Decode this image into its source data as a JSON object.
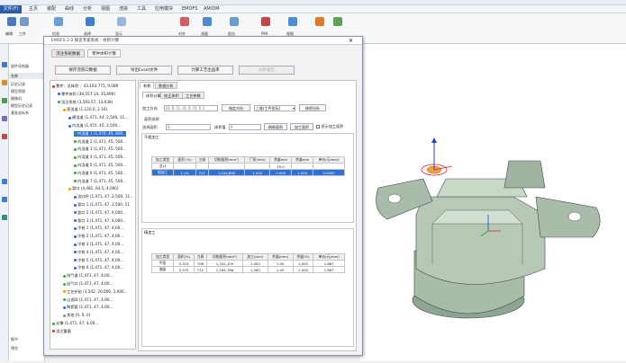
{
  "menu": {
    "file": "文件(F)",
    "items": [
      "主页",
      "装配",
      "曲线",
      "分析",
      "视图",
      "渲染",
      "工具",
      "应用模块",
      "EMOFS",
      "AM/DM"
    ]
  },
  "ribbon": {
    "buttons": [
      "编辑",
      "工件",
      "信息",
      "选择",
      "显示",
      "对齐",
      "测量",
      "报告",
      "PMI",
      "视图"
    ]
  },
  "nav": {
    "title": "部件导航器",
    "header": "名称",
    "rows": [
      "历史记录",
      "模型视图",
      "摄像机",
      "模型历史记录",
      "基准坐标系"
    ],
    "status": [
      "细节",
      "预览"
    ]
  },
  "dialog": {
    "title": "EMOFS 2.0 铸造专家系统 - 体积计算",
    "top_tabs": [
      "浇注系统数据",
      "零件体积计算"
    ],
    "buttons": [
      "保存浇冒口数据",
      "导出Excel文件",
      "计算工艺出品率",
      "分析报告"
    ],
    "tree": [
      "零件：总体积 ：43,163.775, 9,089",
      "零件体积 (39,557.14, 35,690)",
      "浇注系统 (3,593.57, 13,038)",
      "直浇道 (1,120.0, 2.16)",
      "横浇道 (1,471, 44, 2,500, 11...",
      "内浇道 (1,470, 45, 2,500...",
      "内浇道 1 (1,470, 45, 800...",
      "内浇道 2 (1,471, 45, 500...",
      "内浇道 3 (1,471, 45, 500...",
      "内浇道 4 (1,471, 45, 500...",
      "内浇道 5 (1,471, 45, 500...",
      "内浇道 6 (1,471, 45, 500...",
      "内浇道 7 (1,471, 45, 500...",
      "冒口 (4,481, 64.5, 4,000)",
      "浇口杯 (1,471, 47, 2,500, 11...",
      "冒口 1 (1,471, 47, 2,500, 11",
      "冒口 2 (1,471, 47, 4,000...",
      "冒口 3 (1,471, 47, 4,000...",
      "冷铁 1 (1,471, 47, 4,00...",
      "冷铁 2 (1,471, 47, 4,00...",
      "冷铁 3 (1,471, 47, 4,00...",
      "冷铁 4 (1,471, 47, 4,00...",
      "冷铁 5 (1,471, 47, 4,00...",
      "冷铁 6 (1,471, 47, 4,00...",
      "排气道 (1,471, 47, 4,00...",
      "出气口 (1,471, 47, 4,00...",
      "工艺补贴 (3,542, 20,000, 2,000...",
      "过滤网 (1,471, 47, 4,00...",
      "陶瓷管 (1,471, 47, 4,00...",
      "其他 (0, 0, 0)",
      "支撑 (1,471, 47, 4,00...",
      "浇注重量"
    ],
    "panel_tabs": [
      "参数",
      "数据分析"
    ],
    "sub_tabs": [
      "体积计算",
      "修正体积",
      "工艺参数"
    ],
    "form": {
      "label1": "加工方向",
      "value1": "(0, 0, 1), (0, 0, 0), 0.1",
      "btn1": "指定方向",
      "select1": "三维(工件坐标)",
      "btn2": "体积分析",
      "group1": "面积选择",
      "label2": "选择面积",
      "value2": "0",
      "label3": "体积值",
      "value3": "0",
      "btn3": "刷新面积",
      "btn4": "加工面积",
      "check1": "显示加工面积"
    },
    "table1": {
      "title": "干粗加工",
      "headers": [
        "加工类型",
        "面积 (%)",
        "刀具",
        "切削面积(mm²)",
        "厂家(mm)",
        "余量mm",
        "余量mm",
        "单价(元/mm)"
      ],
      "rows": [
        [
          "总计",
          "",
          "",
          "",
          "",
          "",
          "",
          ""
        ],
        [
          "粗加工",
          "1.1%",
          "T07",
          "1,044,880",
          "1.000",
          "0.000",
          "1.000",
          "0.0000"
        ]
      ],
      "summary_row": [
        "",
        "",
        "",
        "",
        "",
        "Σ0.0",
        "",
        ""
      ]
    },
    "table2": {
      "title": "精加工",
      "headers": [
        "加工类型",
        "面积(%)",
        "刀具",
        "切削面积(mm²)",
        "加工(mm)",
        "余量(mm)",
        "余量(%)",
        "单价(元/mm)"
      ],
      "rows": [
        [
          "平面",
          "0.324",
          "T06",
          "1,241,100",
          "1.000",
          "1.00",
          "1.000",
          "1.667"
        ],
        [
          "曲面",
          "0.375",
          "T12",
          "1,164,788",
          "1.260",
          "1.45",
          "1.000",
          "1.667"
        ]
      ]
    }
  }
}
